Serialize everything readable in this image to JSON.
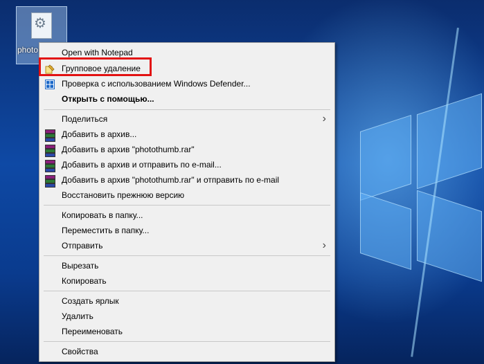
{
  "desktop": {
    "file_label": "photo"
  },
  "menu": {
    "items": [
      {
        "label": "Open with Notepad",
        "icon": "none"
      },
      {
        "label": "Групповое удаление",
        "icon": "bulk-delete-icon"
      },
      {
        "label": "Проверка с использованием Windows Defender...",
        "icon": "windows-defender-icon"
      },
      {
        "label": "Открыть с помощью...",
        "icon": "none",
        "bold": true
      },
      {
        "label": "Поделиться",
        "icon": "none",
        "submenu": true
      },
      {
        "label": "Добавить в архив...",
        "icon": "winrar-icon"
      },
      {
        "label": "Добавить в архив \"photothumb.rar\"",
        "icon": "winrar-icon"
      },
      {
        "label": "Добавить в архив и отправить по e-mail...",
        "icon": "winrar-icon"
      },
      {
        "label": "Добавить в архив \"photothumb.rar\" и отправить по e-mail",
        "icon": "winrar-icon"
      },
      {
        "label": "Восстановить прежнюю версию",
        "icon": "none"
      },
      {
        "label": "Копировать в папку...",
        "icon": "none"
      },
      {
        "label": "Переместить в папку...",
        "icon": "none"
      },
      {
        "label": "Отправить",
        "icon": "none",
        "submenu": true
      },
      {
        "label": "Вырезать",
        "icon": "none"
      },
      {
        "label": "Копировать",
        "icon": "none"
      },
      {
        "label": "Создать ярлык",
        "icon": "none"
      },
      {
        "label": "Удалить",
        "icon": "none"
      },
      {
        "label": "Переименовать",
        "icon": "none"
      },
      {
        "label": "Свойства",
        "icon": "none"
      }
    ]
  },
  "highlight": {
    "target": "Групповое удаление",
    "color": "#e21111"
  }
}
